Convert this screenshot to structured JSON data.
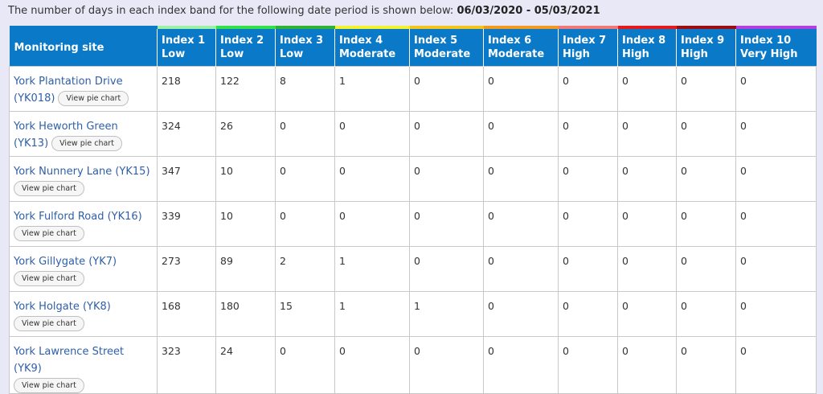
{
  "caption": {
    "text": "The number of days in each index band for the following date period is shown below: ",
    "period": "06/03/2020 - 05/03/2021"
  },
  "colors": {
    "header_bg": "#0a79c8",
    "link": "#2f5fa8",
    "page_bg": "#e9e8f6"
  },
  "columns": [
    {
      "line1": "Monitoring site",
      "line2": ""
    },
    {
      "line1": "Index 1",
      "line2": "Low",
      "band_color": "#9cf0a8"
    },
    {
      "line1": "Index 2",
      "line2": "Low",
      "band_color": "#33e04a"
    },
    {
      "line1": "Index 3",
      "line2": "Low",
      "band_color": "#2fb334"
    },
    {
      "line1": "Index 4",
      "line2": "Moderate",
      "band_color": "#f2f230"
    },
    {
      "line1": "Index 5",
      "line2": "Moderate",
      "band_color": "#f4c41e"
    },
    {
      "line1": "Index 6",
      "line2": "Moderate",
      "band_color": "#f09a22"
    },
    {
      "line1": "Index 7",
      "line2": "High",
      "band_color": "#f07a78"
    },
    {
      "line1": "Index 8",
      "line2": "High",
      "band_color": "#e41a1c"
    },
    {
      "line1": "Index 9",
      "line2": "High",
      "band_color": "#9a0e12"
    },
    {
      "line1": "Index 10",
      "line2": "Very High",
      "band_color": "#b23fe0"
    }
  ],
  "button_label": "View pie chart",
  "rows": [
    {
      "site": "York Plantation Drive",
      "code": "(YK018)",
      "values": [
        "218",
        "122",
        "8",
        "1",
        "0",
        "0",
        "0",
        "0",
        "0",
        "0"
      ]
    },
    {
      "site": "York Heworth Green",
      "code": "(YK13)",
      "values": [
        "324",
        "26",
        "0",
        "0",
        "0",
        "0",
        "0",
        "0",
        "0",
        "0"
      ]
    },
    {
      "site": "York Nunnery Lane (YK15)",
      "code": "",
      "values": [
        "347",
        "10",
        "0",
        "0",
        "0",
        "0",
        "0",
        "0",
        "0",
        "0"
      ]
    },
    {
      "site": "York Fulford Road (YK16)",
      "code": "",
      "values": [
        "339",
        "10",
        "0",
        "0",
        "0",
        "0",
        "0",
        "0",
        "0",
        "0"
      ]
    },
    {
      "site": "York Gillygate (YK7)",
      "code": "",
      "values": [
        "273",
        "89",
        "2",
        "1",
        "0",
        "0",
        "0",
        "0",
        "0",
        "0"
      ]
    },
    {
      "site": "York Holgate (YK8)",
      "code": "",
      "values": [
        "168",
        "180",
        "15",
        "1",
        "1",
        "0",
        "0",
        "0",
        "0",
        "0"
      ]
    },
    {
      "site": "York Lawrence Street (YK9)",
      "code": "",
      "values": [
        "323",
        "24",
        "0",
        "0",
        "0",
        "0",
        "0",
        "0",
        "0",
        "0"
      ]
    }
  ]
}
